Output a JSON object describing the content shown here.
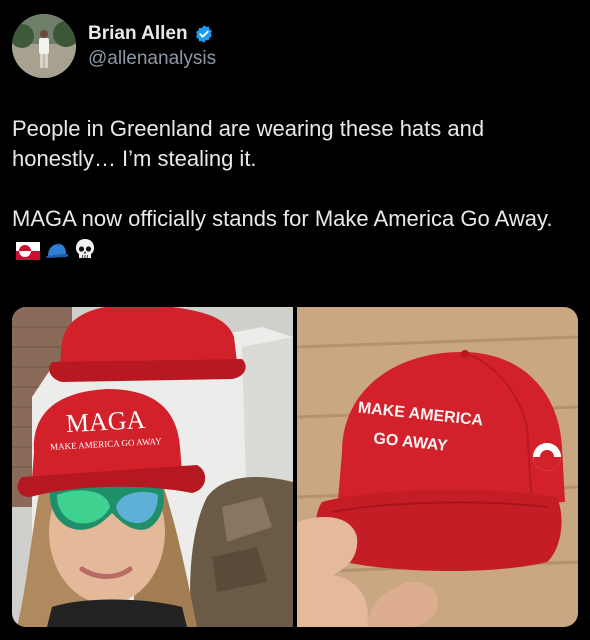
{
  "author": {
    "display_name": "Brian Allen",
    "handle": "@allenanalysis",
    "verified": true,
    "verified_badge_color": "#1d9bf0"
  },
  "tweet": {
    "paragraph_1": "People in Greenland are wearing these hats and honestly… I’m stealing it.",
    "paragraph_2": "MAGA now officially stands for Make America Go Away.",
    "emojis": [
      "greenland-flag-icon",
      "blue-cap-icon",
      "skull-icon"
    ]
  },
  "media": {
    "photo_left": {
      "hat_text_line1": "MAGA",
      "hat_text_line2": "MAKE AMERICA GO AWAY"
    },
    "photo_right": {
      "hat_text_line1": "MAKE AMERICA",
      "hat_text_line2": "GO AWAY"
    }
  },
  "colors": {
    "background": "#000000",
    "text": "#e7e9ea",
    "secondary_text": "#8b98a5",
    "hat_red": "#d3212b"
  }
}
